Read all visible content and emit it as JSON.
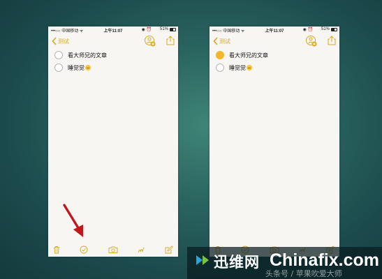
{
  "status_bar": {
    "carrier": "•••○○ 中国移动 ᯤ",
    "time": "上午11:07",
    "alarm": "◉ ⏰",
    "battery": "51%"
  },
  "nav": {
    "back_label": "测试"
  },
  "phones": [
    {
      "notes": [
        {
          "text": "看大师兄的文章",
          "checked": false
        },
        {
          "text": "睡觉觉",
          "checked": false
        }
      ]
    },
    {
      "notes": [
        {
          "text": "看大师兄的文章",
          "checked": true
        },
        {
          "text": "睡觉觉",
          "checked": false
        }
      ]
    }
  ],
  "icons": {
    "back": "chevron-left-icon",
    "collaborate": "add-person-icon",
    "share": "share-icon",
    "delete": "trash-icon",
    "checklist": "checkmark-circle-icon",
    "camera": "camera-icon",
    "draw": "sketch-icon",
    "compose": "compose-icon",
    "pointer": "red-arrow"
  },
  "colors": {
    "accent": "#d9a81e",
    "checked": "#f3b72a",
    "arrow": "#c0171c"
  },
  "watermark": {
    "chinese": "迅维网",
    "english": "Chinafix.com",
    "subtitle": "头条号 / 苹果吹爱大师"
  }
}
